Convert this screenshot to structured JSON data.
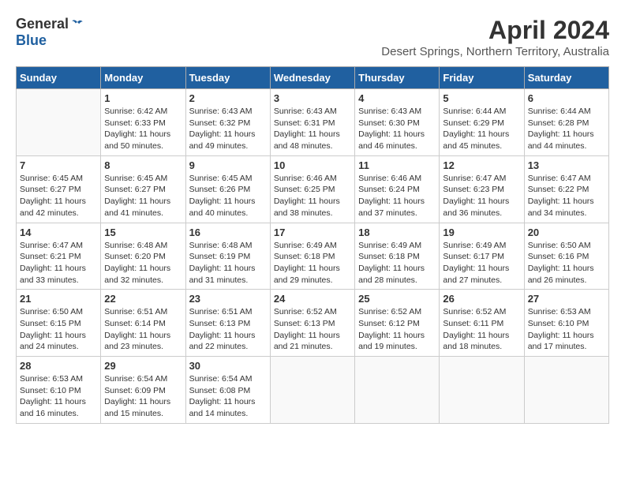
{
  "header": {
    "logo_general": "General",
    "logo_blue": "Blue",
    "title": "April 2024",
    "subtitle": "Desert Springs, Northern Territory, Australia"
  },
  "calendar": {
    "days_of_week": [
      "Sunday",
      "Monday",
      "Tuesday",
      "Wednesday",
      "Thursday",
      "Friday",
      "Saturday"
    ],
    "weeks": [
      [
        {
          "day": "",
          "info": ""
        },
        {
          "day": "1",
          "info": "Sunrise: 6:42 AM\nSunset: 6:33 PM\nDaylight: 11 hours\nand 50 minutes."
        },
        {
          "day": "2",
          "info": "Sunrise: 6:43 AM\nSunset: 6:32 PM\nDaylight: 11 hours\nand 49 minutes."
        },
        {
          "day": "3",
          "info": "Sunrise: 6:43 AM\nSunset: 6:31 PM\nDaylight: 11 hours\nand 48 minutes."
        },
        {
          "day": "4",
          "info": "Sunrise: 6:43 AM\nSunset: 6:30 PM\nDaylight: 11 hours\nand 46 minutes."
        },
        {
          "day": "5",
          "info": "Sunrise: 6:44 AM\nSunset: 6:29 PM\nDaylight: 11 hours\nand 45 minutes."
        },
        {
          "day": "6",
          "info": "Sunrise: 6:44 AM\nSunset: 6:28 PM\nDaylight: 11 hours\nand 44 minutes."
        }
      ],
      [
        {
          "day": "7",
          "info": "Sunrise: 6:45 AM\nSunset: 6:27 PM\nDaylight: 11 hours\nand 42 minutes."
        },
        {
          "day": "8",
          "info": "Sunrise: 6:45 AM\nSunset: 6:27 PM\nDaylight: 11 hours\nand 41 minutes."
        },
        {
          "day": "9",
          "info": "Sunrise: 6:45 AM\nSunset: 6:26 PM\nDaylight: 11 hours\nand 40 minutes."
        },
        {
          "day": "10",
          "info": "Sunrise: 6:46 AM\nSunset: 6:25 PM\nDaylight: 11 hours\nand 38 minutes."
        },
        {
          "day": "11",
          "info": "Sunrise: 6:46 AM\nSunset: 6:24 PM\nDaylight: 11 hours\nand 37 minutes."
        },
        {
          "day": "12",
          "info": "Sunrise: 6:47 AM\nSunset: 6:23 PM\nDaylight: 11 hours\nand 36 minutes."
        },
        {
          "day": "13",
          "info": "Sunrise: 6:47 AM\nSunset: 6:22 PM\nDaylight: 11 hours\nand 34 minutes."
        }
      ],
      [
        {
          "day": "14",
          "info": "Sunrise: 6:47 AM\nSunset: 6:21 PM\nDaylight: 11 hours\nand 33 minutes."
        },
        {
          "day": "15",
          "info": "Sunrise: 6:48 AM\nSunset: 6:20 PM\nDaylight: 11 hours\nand 32 minutes."
        },
        {
          "day": "16",
          "info": "Sunrise: 6:48 AM\nSunset: 6:19 PM\nDaylight: 11 hours\nand 31 minutes."
        },
        {
          "day": "17",
          "info": "Sunrise: 6:49 AM\nSunset: 6:18 PM\nDaylight: 11 hours\nand 29 minutes."
        },
        {
          "day": "18",
          "info": "Sunrise: 6:49 AM\nSunset: 6:18 PM\nDaylight: 11 hours\nand 28 minutes."
        },
        {
          "day": "19",
          "info": "Sunrise: 6:49 AM\nSunset: 6:17 PM\nDaylight: 11 hours\nand 27 minutes."
        },
        {
          "day": "20",
          "info": "Sunrise: 6:50 AM\nSunset: 6:16 PM\nDaylight: 11 hours\nand 26 minutes."
        }
      ],
      [
        {
          "day": "21",
          "info": "Sunrise: 6:50 AM\nSunset: 6:15 PM\nDaylight: 11 hours\nand 24 minutes."
        },
        {
          "day": "22",
          "info": "Sunrise: 6:51 AM\nSunset: 6:14 PM\nDaylight: 11 hours\nand 23 minutes."
        },
        {
          "day": "23",
          "info": "Sunrise: 6:51 AM\nSunset: 6:13 PM\nDaylight: 11 hours\nand 22 minutes."
        },
        {
          "day": "24",
          "info": "Sunrise: 6:52 AM\nSunset: 6:13 PM\nDaylight: 11 hours\nand 21 minutes."
        },
        {
          "day": "25",
          "info": "Sunrise: 6:52 AM\nSunset: 6:12 PM\nDaylight: 11 hours\nand 19 minutes."
        },
        {
          "day": "26",
          "info": "Sunrise: 6:52 AM\nSunset: 6:11 PM\nDaylight: 11 hours\nand 18 minutes."
        },
        {
          "day": "27",
          "info": "Sunrise: 6:53 AM\nSunset: 6:10 PM\nDaylight: 11 hours\nand 17 minutes."
        }
      ],
      [
        {
          "day": "28",
          "info": "Sunrise: 6:53 AM\nSunset: 6:10 PM\nDaylight: 11 hours\nand 16 minutes."
        },
        {
          "day": "29",
          "info": "Sunrise: 6:54 AM\nSunset: 6:09 PM\nDaylight: 11 hours\nand 15 minutes."
        },
        {
          "day": "30",
          "info": "Sunrise: 6:54 AM\nSunset: 6:08 PM\nDaylight: 11 hours\nand 14 minutes."
        },
        {
          "day": "",
          "info": ""
        },
        {
          "day": "",
          "info": ""
        },
        {
          "day": "",
          "info": ""
        },
        {
          "day": "",
          "info": ""
        }
      ]
    ]
  }
}
